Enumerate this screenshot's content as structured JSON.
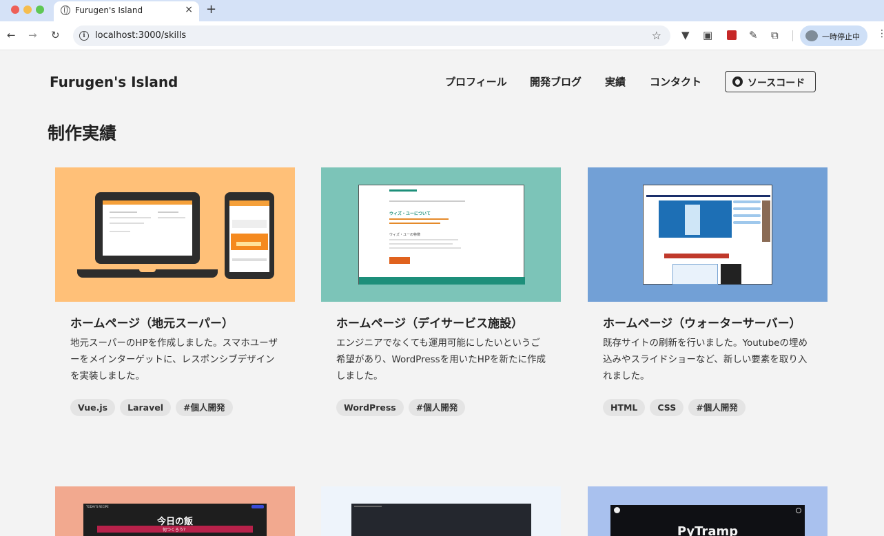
{
  "browser": {
    "tab_title": "Furugen's Island",
    "tab_close": "×",
    "new_tab": "+",
    "url": "localhost:3000/skills",
    "profile_status": "一時停止中"
  },
  "header": {
    "logo": "Furugen's Island",
    "nav": [
      "プロフィール",
      "開発ブログ",
      "実績",
      "コンタクト"
    ],
    "source_button": "ソースコード"
  },
  "page": {
    "title": "制作実績"
  },
  "cards": [
    {
      "title": "ホームページ（地元スーパー）",
      "description": "地元スーパーのHPを作成しました。スマホユーザーをメインターゲットに、レスポンシブデザインを実装しました。",
      "tags": [
        "Vue.js",
        "Laravel",
        "#個人開発"
      ],
      "thumb_color": "#ffc078"
    },
    {
      "title": "ホームページ（デイサービス施設）",
      "description": "エンジニアでなくても運用可能にしたいというご希望があり、WordPressを用いたHPを新たに作成しました。",
      "tags": [
        "WordPress",
        "#個人開発"
      ],
      "thumb_color": "#7cc4b8",
      "mock_heading": "ウィズ・ユーについて",
      "mock_sub": "ウィズ・ユーの特徴"
    },
    {
      "title": "ホームページ（ウォーターサーバー）",
      "description": "既存サイトの刷新を行いました。Youtubeの埋め込みやスライドショーなど、新しい要素を取り入れました。",
      "tags": [
        "HTML",
        "CSS",
        "#個人開発"
      ],
      "thumb_color": "#72a0d6"
    },
    {
      "thumb_color": "#f2a98f",
      "mock_title": "今日の飯",
      "mock_sub": "何つくろう？",
      "mock_label": "TODAY'S RECIPE"
    },
    {
      "thumb_color": "#eef4fb"
    },
    {
      "thumb_color": "#a9c1ee",
      "mock_title": "PyTramp"
    }
  ]
}
